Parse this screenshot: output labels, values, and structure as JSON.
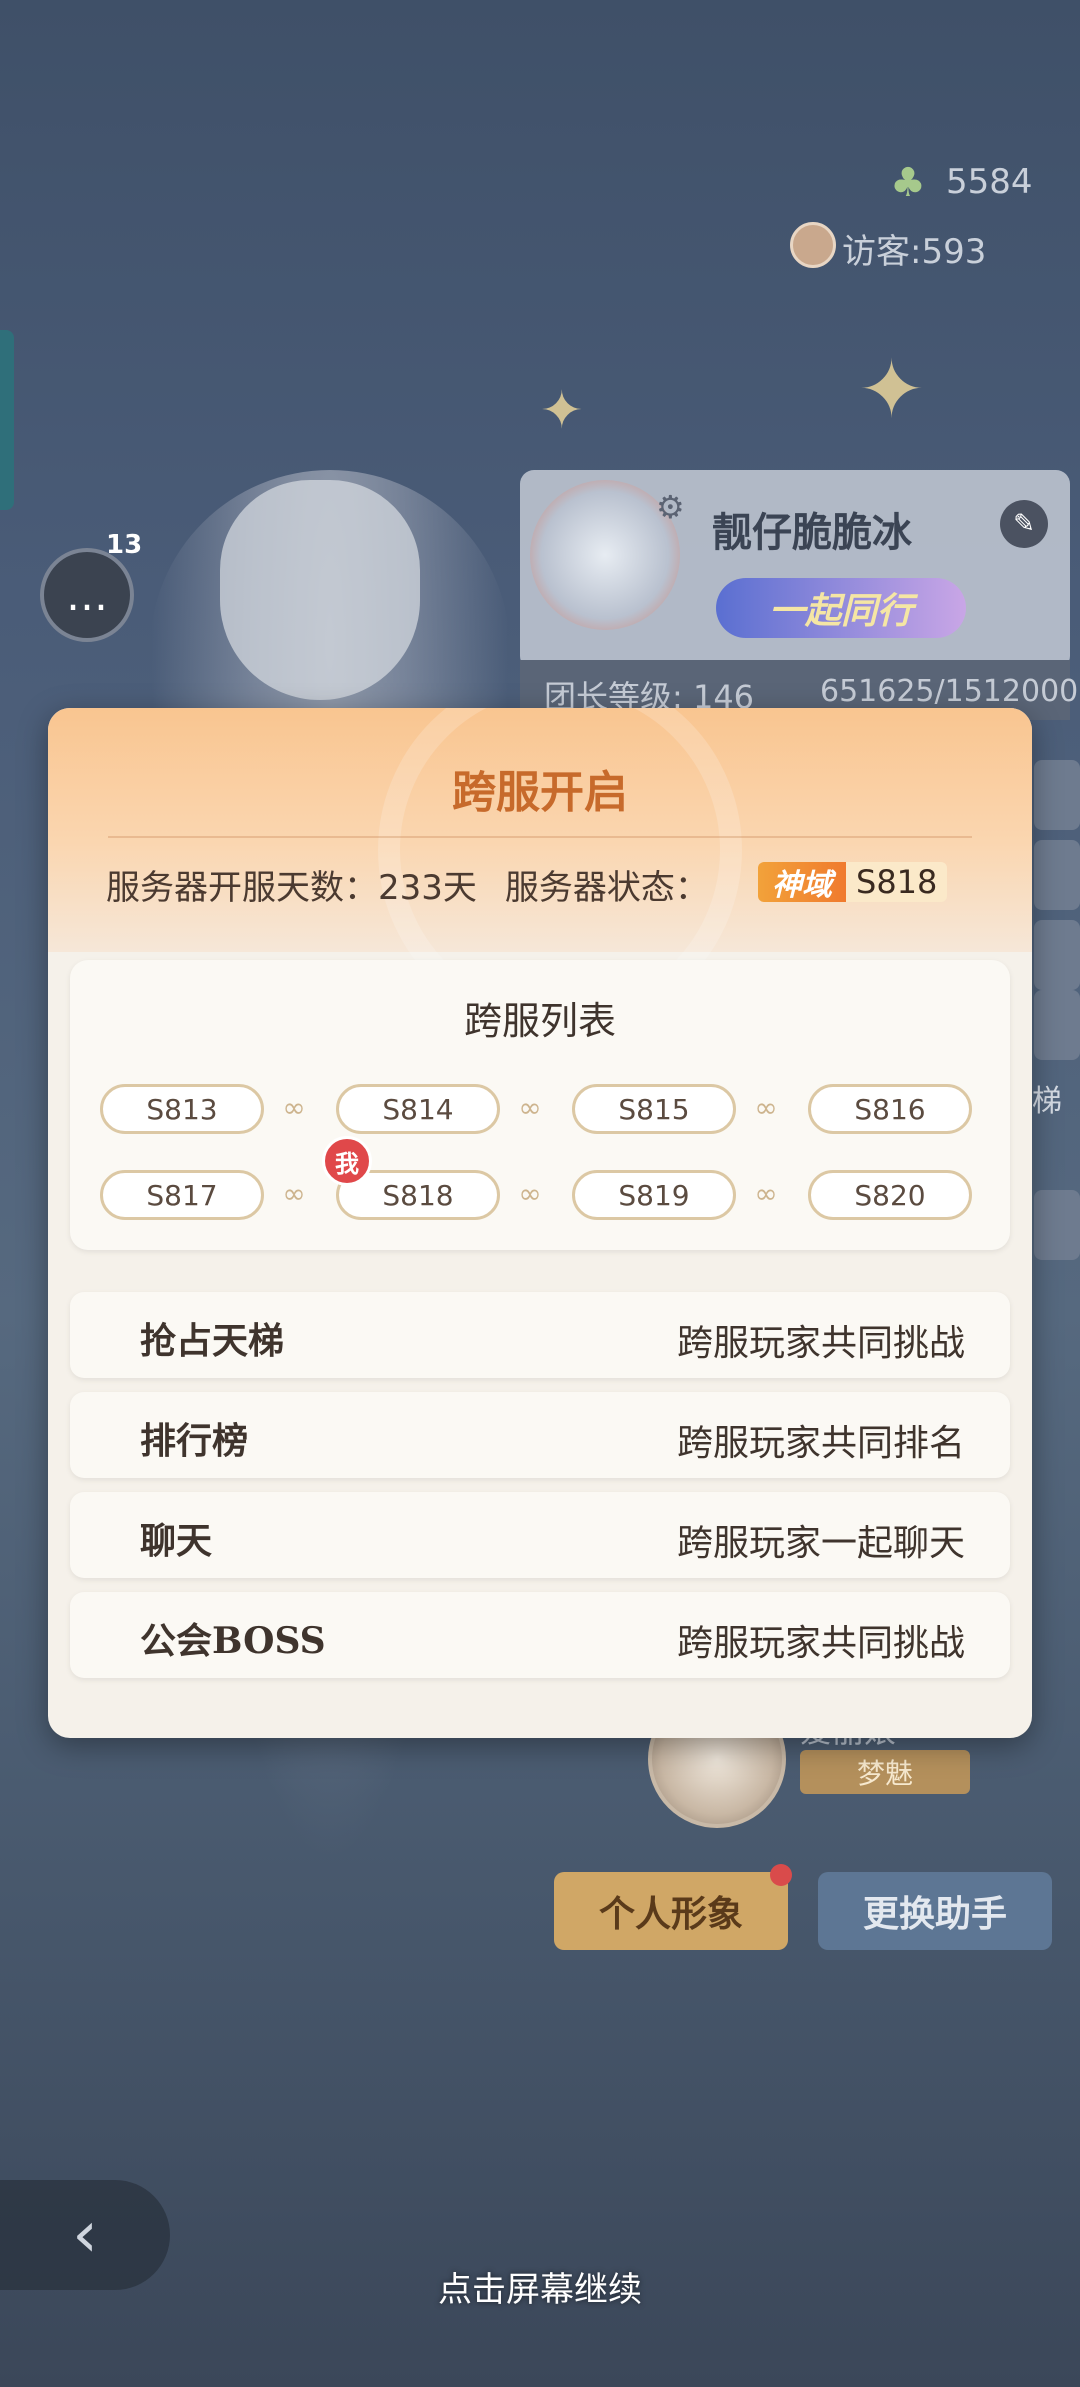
{
  "top_stats": {
    "clover_value": "5584",
    "visitors": "访客:593"
  },
  "chat": {
    "unread_count": "13"
  },
  "profile": {
    "name": "靓仔脆脆冰",
    "title_badge": "一起同行",
    "level_label": "团长等级: 146",
    "exp": "651625/1512000"
  },
  "right_peek": {
    "ladder_fragment": "梯"
  },
  "assistant": {
    "name": "爱丽娘",
    "tag": "梦魅"
  },
  "buttons": {
    "personal_image": "个人形象",
    "change_assistant": "更换助手"
  },
  "dialog": {
    "title": "跨服开启",
    "open_days": "服务器开服天数：233天",
    "status_label": "服务器状态：",
    "status_badge": "神域",
    "status_server": "S818",
    "list_title": "跨服列表",
    "me_label": "我",
    "servers_row1": [
      "S813",
      "S814",
      "S815",
      "S816"
    ],
    "servers_row2": [
      "S817",
      "S818",
      "S819",
      "S820"
    ],
    "features": [
      {
        "name": "抢占天梯",
        "desc": "跨服玩家共同挑战"
      },
      {
        "name": "排行榜",
        "desc": "跨服玩家共同排名"
      },
      {
        "name": "聊天",
        "desc": "跨服玩家一起聊天"
      },
      {
        "name": "公会BOSS",
        "desc": "跨服玩家共同挑战"
      }
    ]
  },
  "footer": {
    "continue_hint": "点击屏幕继续"
  },
  "icons": [
    "clover-icon",
    "visitor-icon",
    "chat-icon",
    "gear-icon",
    "edit-icon",
    "link-icon",
    "back-arrow-icon"
  ]
}
